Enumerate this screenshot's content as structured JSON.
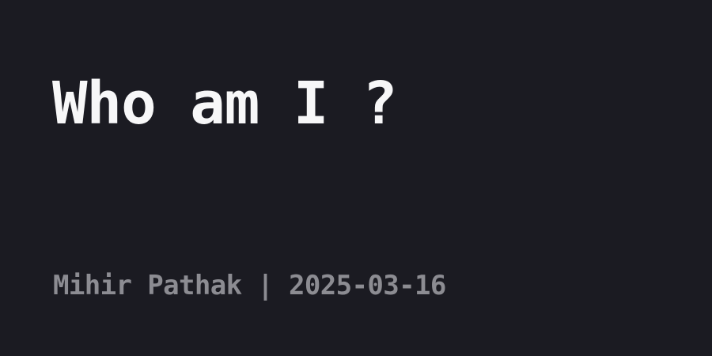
{
  "post": {
    "title": "Who am I ?",
    "author": "Mihir Pathak",
    "separator": " | ",
    "date": "2025-03-16"
  },
  "colors": {
    "background": "#1b1b22",
    "title": "#f7f7f8",
    "meta": "#8c8c92"
  }
}
